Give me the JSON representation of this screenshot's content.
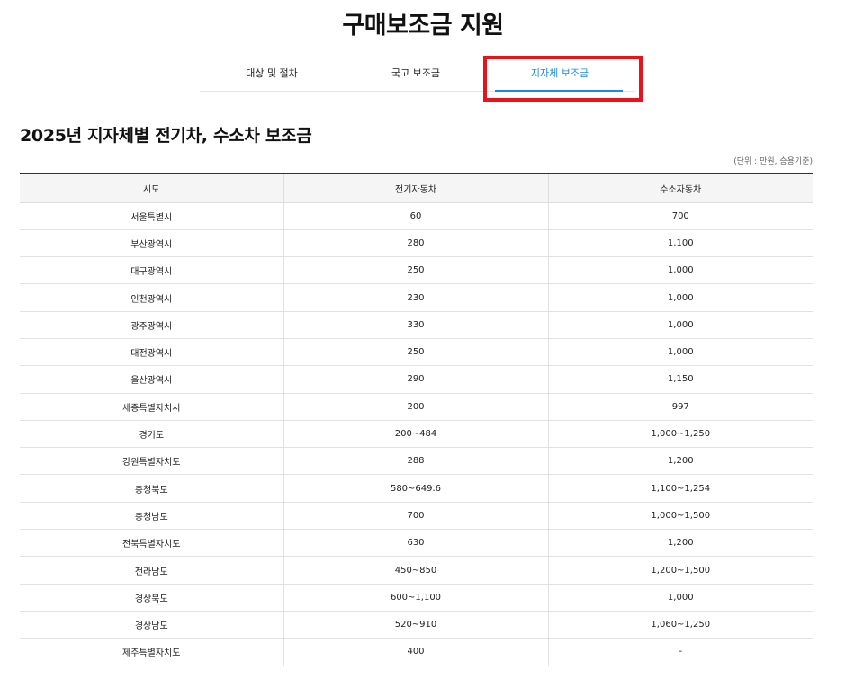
{
  "page_title": "구매보조금 지원",
  "tabs": [
    {
      "label": "대상 및 절차",
      "active": false
    },
    {
      "label": "국고 보조금",
      "active": false
    },
    {
      "label": "지자체 보조금",
      "active": true
    }
  ],
  "section_title": "2025년 지자체별 전기차, 수소차 보조금",
  "unit_note": "(단위 : 만원, 승용기준)",
  "table": {
    "headers": [
      "시도",
      "전기자동차",
      "수소자동차"
    ],
    "rows": [
      [
        "서울특별시",
        "60",
        "700"
      ],
      [
        "부산광역시",
        "280",
        "1,100"
      ],
      [
        "대구광역시",
        "250",
        "1,000"
      ],
      [
        "인천광역시",
        "230",
        "1,000"
      ],
      [
        "광주광역시",
        "330",
        "1,000"
      ],
      [
        "대전광역시",
        "250",
        "1,000"
      ],
      [
        "울산광역시",
        "290",
        "1,150"
      ],
      [
        "세종특별자치시",
        "200",
        "997"
      ],
      [
        "경기도",
        "200~484",
        "1,000~1,250"
      ],
      [
        "강원특별자치도",
        "288",
        "1,200"
      ],
      [
        "충청북도",
        "580~649.6",
        "1,100~1,254"
      ],
      [
        "충청남도",
        "700",
        "1,000~1,500"
      ],
      [
        "전북특별자치도",
        "630",
        "1,200"
      ],
      [
        "전라남도",
        "450~850",
        "1,200~1,500"
      ],
      [
        "경상북도",
        "600~1,100",
        "1,000"
      ],
      [
        "경상남도",
        "520~910",
        "1,060~1,250"
      ],
      [
        "제주특별자치도",
        "400",
        "-"
      ]
    ]
  },
  "colors": {
    "accent": "#1e88e5",
    "highlight": "#e8141c"
  }
}
